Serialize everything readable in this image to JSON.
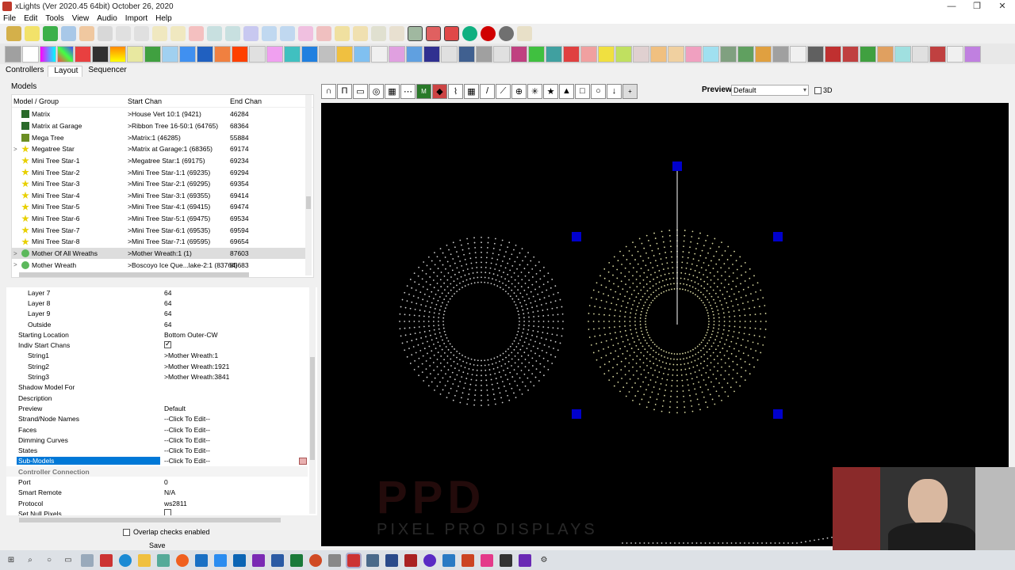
{
  "window": {
    "title": "xLights (Ver 2020.45 64bit) October 26, 2020",
    "minimize": "—",
    "restore": "❐",
    "close": "✕"
  },
  "menu": [
    "File",
    "Edit",
    "Tools",
    "View",
    "Audio",
    "Import",
    "Help"
  ],
  "tabs": [
    "Controllers",
    "Layout",
    "Sequencer"
  ],
  "models_panel": {
    "label": "Models",
    "headers": {
      "name": "Model / Group",
      "start": "Start Chan",
      "end": "End Chan"
    },
    "rows": [
      {
        "name": "Matrix",
        "start": ">House Vert 10:1 (9421)",
        "end": "46284",
        "icon": "matrix-icon",
        "color": "#2a6a2a",
        "expand": ""
      },
      {
        "name": "Matrix at Garage",
        "start": ">Ribbon Tree 16-50:1 (64765)",
        "end": "68364",
        "icon": "matrix-icon",
        "color": "#2a6a2a",
        "expand": ""
      },
      {
        "name": "Mega Tree",
        "start": ">Matrix:1 (46285)",
        "end": "55884",
        "icon": "tree-icon",
        "color": "#6b8e23",
        "expand": ""
      },
      {
        "name": "Megatree Star",
        "start": ">Matrix at Garage:1 (68365)",
        "end": "69174",
        "icon": "star-icon",
        "color": "#e8d000",
        "expand": ">"
      },
      {
        "name": "Mini Tree Star-1",
        "start": ">Megatree Star:1 (69175)",
        "end": "69234",
        "icon": "star-icon",
        "color": "#e8d000",
        "expand": ""
      },
      {
        "name": "Mini Tree Star-2",
        "start": ">Mini Tree Star-1:1 (69235)",
        "end": "69294",
        "icon": "star-icon",
        "color": "#e8d000",
        "expand": ""
      },
      {
        "name": "Mini Tree Star-3",
        "start": ">Mini Tree Star-2:1 (69295)",
        "end": "69354",
        "icon": "star-icon",
        "color": "#e8d000",
        "expand": ""
      },
      {
        "name": "Mini Tree Star-4",
        "start": ">Mini Tree Star-3:1 (69355)",
        "end": "69414",
        "icon": "star-icon",
        "color": "#e8d000",
        "expand": ""
      },
      {
        "name": "Mini Tree Star-5",
        "start": ">Mini Tree Star-4:1 (69415)",
        "end": "69474",
        "icon": "star-icon",
        "color": "#e8d000",
        "expand": ""
      },
      {
        "name": "Mini Tree Star-6",
        "start": ">Mini Tree Star-5:1 (69475)",
        "end": "69534",
        "icon": "star-icon",
        "color": "#e8d000",
        "expand": ""
      },
      {
        "name": "Mini Tree Star-7",
        "start": ">Mini Tree Star-6:1 (69535)",
        "end": "69594",
        "icon": "star-icon",
        "color": "#e8d000",
        "expand": ""
      },
      {
        "name": "Mini Tree Star-8",
        "start": ">Mini Tree Star-7:1 (69595)",
        "end": "69654",
        "icon": "star-icon",
        "color": "#e8d000",
        "expand": ""
      },
      {
        "name": "Mother Of All Wreaths",
        "start": ">Mother Wreath:1 (1)",
        "end": "87603",
        "icon": "wreath-icon",
        "color": "#5cb85c",
        "expand": ">",
        "selected": true
      },
      {
        "name": "Mother Wreath",
        "start": ">Boscoyo Ice Que...lake-2:1 (83764)",
        "end": "85683",
        "icon": "wreath-icon",
        "color": "#5cb85c",
        "expand": ">"
      }
    ]
  },
  "properties": [
    {
      "k": "Layer 7",
      "v": "64",
      "type": "sub"
    },
    {
      "k": "Layer 8",
      "v": "64",
      "type": "sub"
    },
    {
      "k": "Layer 9",
      "v": "64",
      "type": "sub"
    },
    {
      "k": "Outside",
      "v": "64",
      "type": "sub"
    },
    {
      "k": "Starting Location",
      "v": "Bottom Outer-CW",
      "type": ""
    },
    {
      "k": "Indiv Start Chans",
      "v": "",
      "type": "check-on"
    },
    {
      "k": "String1",
      "v": ">Mother Wreath:1",
      "type": "sub"
    },
    {
      "k": "String2",
      "v": ">Mother Wreath:1921",
      "type": "sub"
    },
    {
      "k": "String3",
      "v": ">Mother Wreath:3841",
      "type": "sub"
    },
    {
      "k": "Shadow Model For",
      "v": "",
      "type": ""
    },
    {
      "k": "Description",
      "v": "",
      "type": ""
    },
    {
      "k": "Preview",
      "v": "Default",
      "type": ""
    },
    {
      "k": "Strand/Node Names",
      "v": "--Click To Edit--",
      "type": ""
    },
    {
      "k": "Faces",
      "v": "--Click To Edit--",
      "type": ""
    },
    {
      "k": "Dimming Curves",
      "v": "--Click To Edit--",
      "type": ""
    },
    {
      "k": "States",
      "v": "--Click To Edit--",
      "type": ""
    },
    {
      "k": "Sub-Models",
      "v": "--Click To Edit--",
      "type": "selected"
    },
    {
      "k": "Controller Connection",
      "v": "",
      "type": "cat"
    },
    {
      "k": "Port",
      "v": "0",
      "type": ""
    },
    {
      "k": "Smart Remote",
      "v": "N/A",
      "type": ""
    },
    {
      "k": "Protocol",
      "v": "ws2811",
      "type": ""
    },
    {
      "k": "Set Null Pixels",
      "v": "",
      "type": "check-off"
    }
  ],
  "footer": {
    "overlap_label": "Overlap checks enabled",
    "save_label": "Save"
  },
  "preview": {
    "label": "Preview:",
    "selected": "Default",
    "label_3d": "3D"
  },
  "canvas_tools": [
    "arch-icon",
    "candycane-icon",
    "channelblock-icon",
    "circle-icon",
    "cube-icon",
    "custom-icon",
    "dmx-icon",
    "image-icon",
    "icicles-icon",
    "matrix-icon",
    "line-icon",
    "polyline-icon",
    "sphere-icon",
    "spinner-icon",
    "star-icon",
    "tree-icon",
    "window-icon",
    "wreath-icon",
    "import-icon",
    "add-object-icon"
  ],
  "watermark": {
    "line1": "PPD",
    "line2": "PIXEL PRO DISPLAYS"
  },
  "colors": {
    "selection": "#0078d7",
    "handle": "#0000cc",
    "pixels": "#d8d8a8",
    "canvas": "#000000"
  }
}
